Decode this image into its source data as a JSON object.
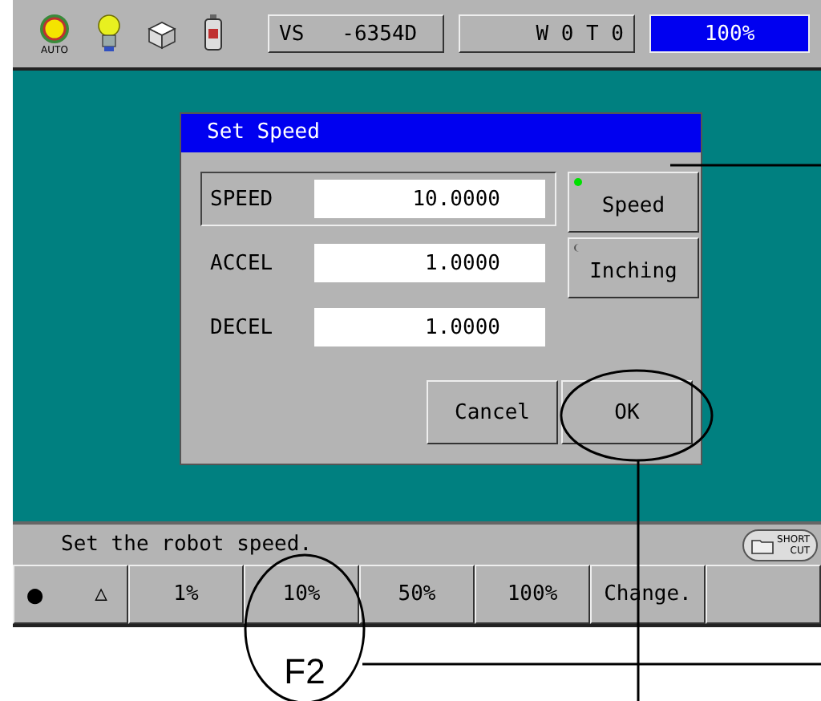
{
  "status_bar": {
    "mode_label": "AUTO",
    "robot_field": "VS   -6354D",
    "tool_field": "W 0 T 0",
    "speed_override": "100%"
  },
  "dialog": {
    "title": "Set Speed",
    "fields": [
      {
        "label": "SPEED",
        "value": "10.0000",
        "selected": true
      },
      {
        "label": "ACCEL",
        "value": "1.0000",
        "selected": false
      },
      {
        "label": "DECEL",
        "value": "1.0000",
        "selected": false
      }
    ],
    "mode_buttons": [
      {
        "label": "Speed",
        "selected": true
      },
      {
        "label": "Inching",
        "selected": false
      }
    ],
    "buttons": [
      "Cancel",
      "OK"
    ]
  },
  "message": "Set the robot speed.",
  "shortcut_button": {
    "line_1": "SHORT",
    "line_2": "CUT"
  },
  "function_keys": [
    {
      "kind": "indicator",
      "symbols": [
        "●",
        "△"
      ]
    },
    {
      "kind": "label",
      "label": "1%"
    },
    {
      "kind": "label",
      "label": "10%"
    },
    {
      "kind": "label",
      "label": "50%"
    },
    {
      "kind": "label",
      "label": "100%"
    },
    {
      "kind": "label",
      "label": "Change."
    },
    {
      "kind": "blank"
    }
  ],
  "annotation": {
    "label": "F2"
  }
}
